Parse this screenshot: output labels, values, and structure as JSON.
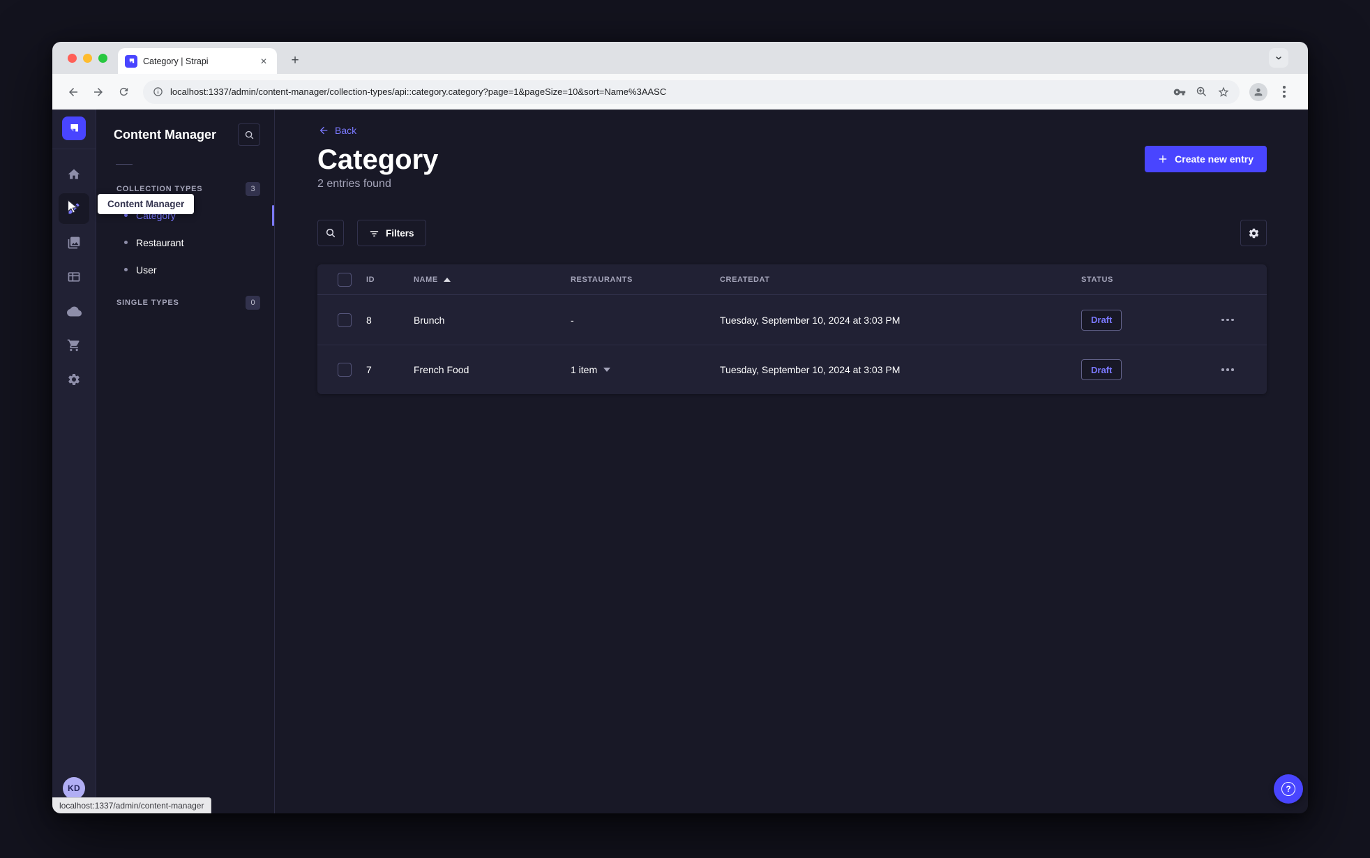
{
  "colors": {
    "accent": "#4945ff",
    "link": "#7b79ff",
    "page_background": "#181826",
    "surface": "#212134",
    "border": "#32324d",
    "muted_text": "#a5a5ba"
  },
  "browser": {
    "tab_title": "Category | Strapi",
    "url": "localhost:1337/admin/content-manager/collection-types/api::category.category?page=1&pageSize=10&sort=Name%3AASC",
    "status_bar": "localhost:1337/admin/content-manager"
  },
  "icons": {
    "new_tab_glyph": "+",
    "tab_close_glyph": "✕",
    "help_glyph": "?"
  },
  "sidebar": {
    "tooltip": "Content Manager",
    "user_initials": "KD"
  },
  "panel": {
    "title": "Content Manager",
    "collection_types": {
      "label": "COLLECTION TYPES",
      "count": "3",
      "items": [
        "Category",
        "Restaurant",
        "User"
      ]
    },
    "single_types": {
      "label": "SINGLE TYPES",
      "count": "0"
    }
  },
  "main": {
    "back_label": "Back",
    "title": "Category",
    "subtitle": "2 entries found",
    "create_button": "Create new entry",
    "filters_button": "Filters",
    "table": {
      "headers": [
        "ID",
        "NAME",
        "RESTAURANTS",
        "CREATEDAT",
        "STATUS"
      ],
      "rows": [
        {
          "id": "8",
          "name": "Brunch",
          "restaurants": "-",
          "created_at": "Tuesday, September 10, 2024 at 3:03 PM",
          "status": "Draft"
        },
        {
          "id": "7",
          "name": "French Food",
          "restaurants": "1 item",
          "created_at": "Tuesday, September 10, 2024 at 3:03 PM",
          "status": "Draft"
        }
      ]
    }
  }
}
